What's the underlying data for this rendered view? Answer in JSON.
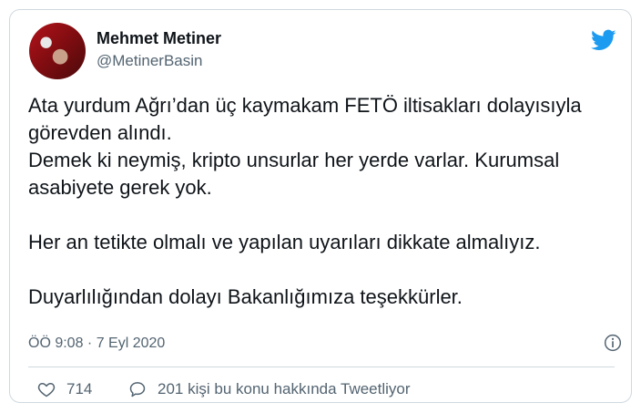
{
  "author": {
    "name": "Mehmet Metiner",
    "handle": "@MetinerBasin"
  },
  "tweet": {
    "lines": [
      "Ata yurdum Ağrı’dan üç kaymakam FETÖ iltisakları dolayısıyla",
      "görevden alındı.",
      "Demek ki neymiş, kripto unsurlar her yerde varlar. Kurumsal",
      "asabiyete gerek yok.",
      "Her an tetikte olmalı ve yapılan uyarıları dikkate almalıyız.",
      "Duyarlılığından dolayı Bakanlığımıza teşekkürler."
    ],
    "timestamp": "ÖÖ 9:08 · 7 Eyl 2020"
  },
  "actions": {
    "like_count": "714",
    "discussion_text": "201 kişi bu konu hakkında Tweetliyor"
  },
  "icons": {
    "brand": "twitter-bird-icon",
    "info": "info-icon",
    "like": "heart-icon",
    "reply": "speech-bubble-icon"
  },
  "colors": {
    "brand": "#1d9bf0",
    "secondary_text": "#536471",
    "border": "#cfd9de"
  }
}
